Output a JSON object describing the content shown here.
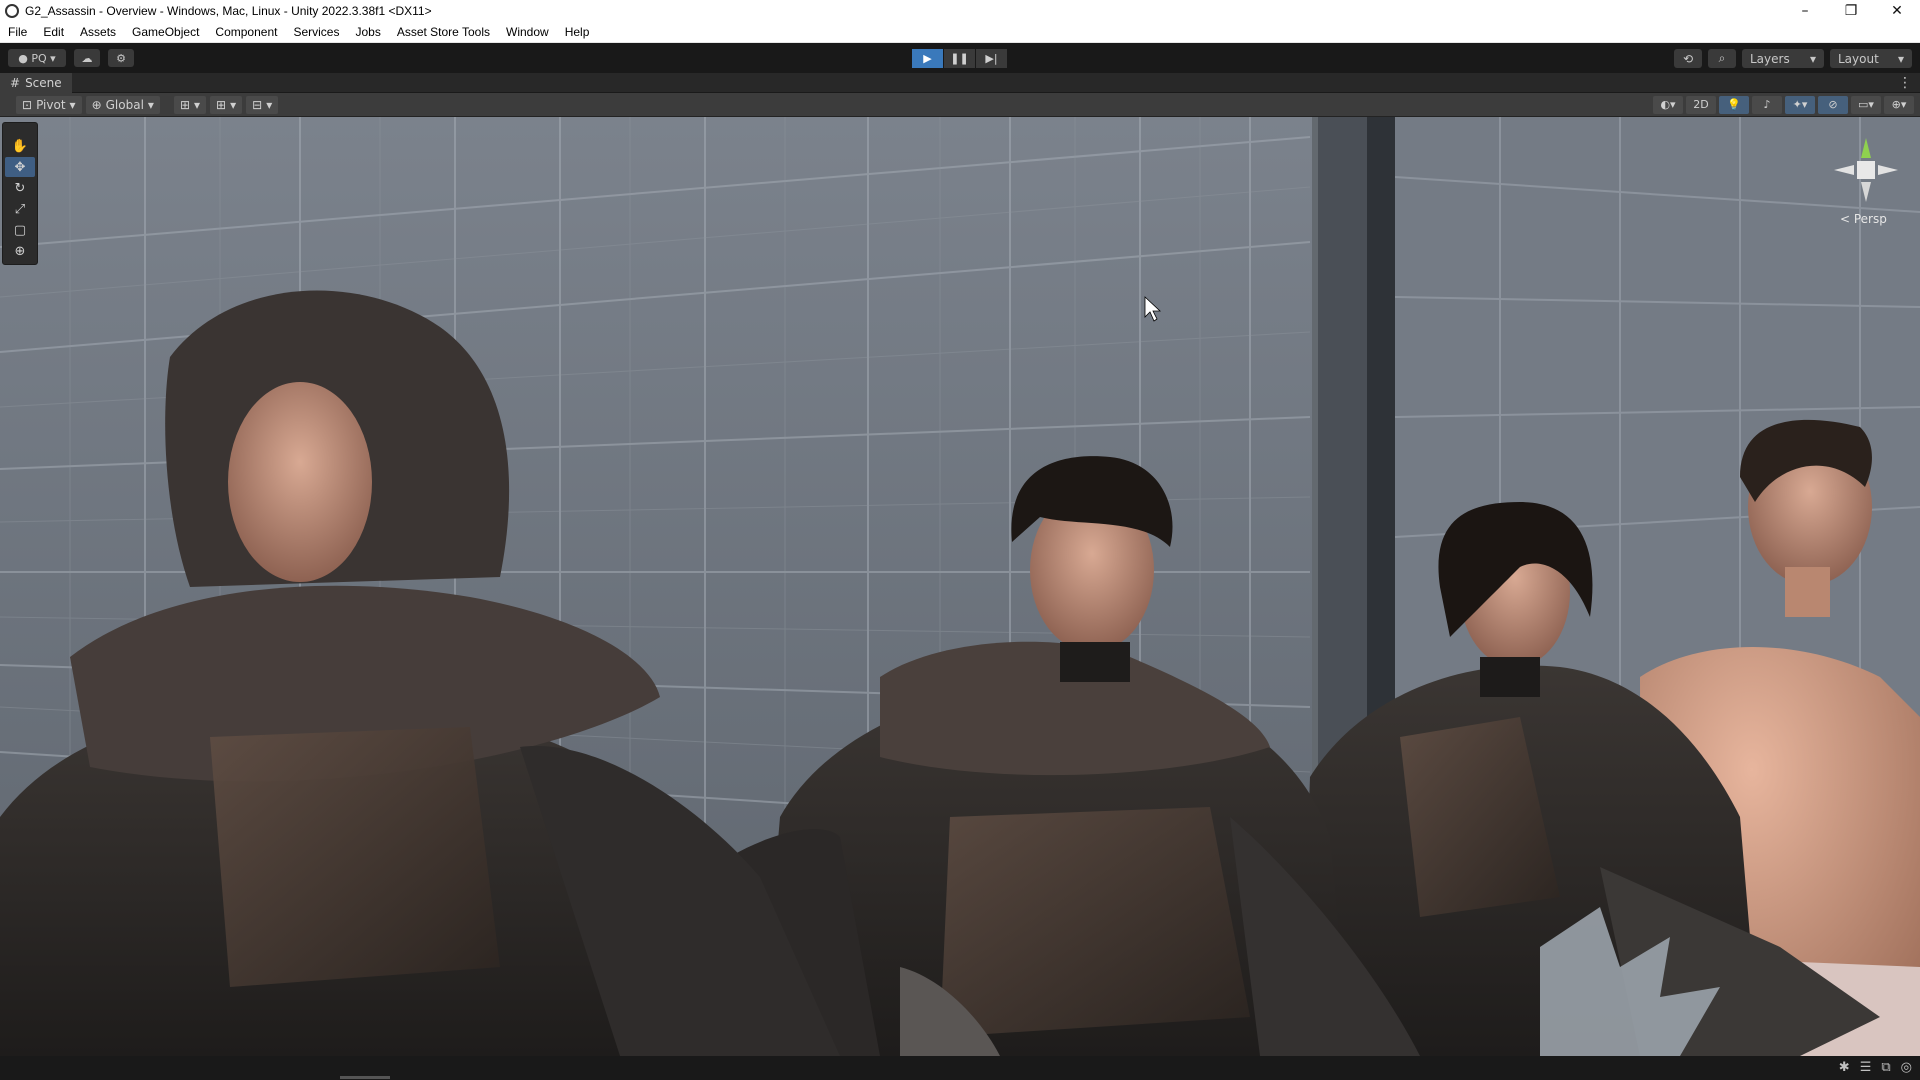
{
  "window": {
    "title": "G2_Assassin - Overview - Windows, Mac, Linux - Unity 2022.3.38f1 <DX11>",
    "controls": {
      "minimize": "–",
      "restore": "❐",
      "close": "✕"
    }
  },
  "menubar": {
    "items": [
      "File",
      "Edit",
      "Assets",
      "GameObject",
      "Component",
      "Services",
      "Jobs",
      "Asset Store Tools",
      "Window",
      "Help"
    ]
  },
  "toolbar": {
    "account_label": "PQ",
    "play_label": "▶",
    "pause_label": "❚❚",
    "step_label": "▶|",
    "layers_label": "Layers",
    "layout_label": "Layout"
  },
  "scene_tab": {
    "label": "Scene"
  },
  "scene_toolbar": {
    "pivot_label": "Pivot",
    "global_label": "Global",
    "twod_label": "2D"
  },
  "viewport": {
    "camera_mode": "< Persp",
    "play_mode_active": true
  },
  "colors": {
    "play_active": "#3a79bb",
    "selected_tool": "#3f5e83",
    "axis_y": "#8fd14f",
    "axis_x": "#e2e2e2"
  }
}
